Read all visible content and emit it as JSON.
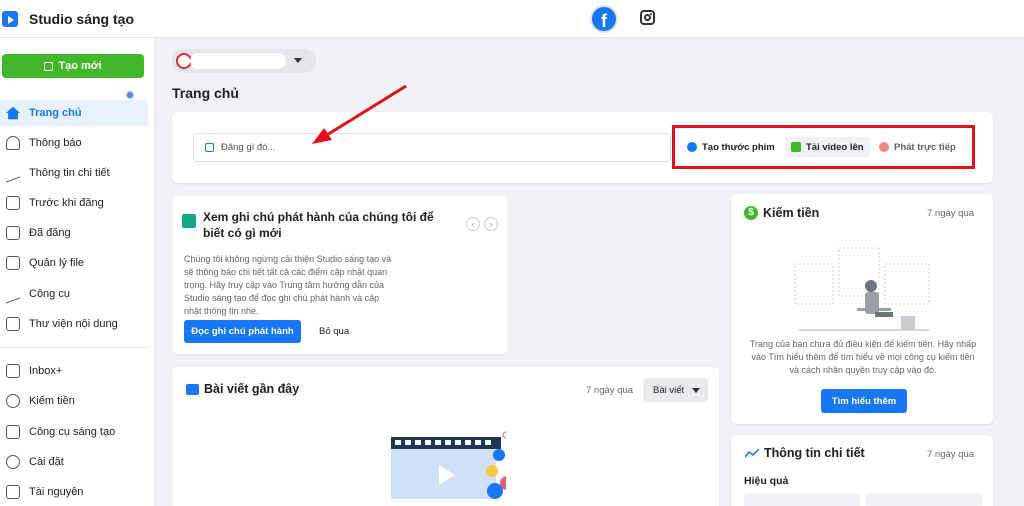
{
  "app": {
    "title": "Studio sáng tạo"
  },
  "topbar": {
    "platforms": [
      "facebook-icon",
      "instagram-icon"
    ]
  },
  "sidebar": {
    "create_label": "Tạo mới",
    "items": [
      {
        "label": "Trang chủ",
        "icon": "home-icon",
        "active": true
      },
      {
        "label": "Thông báo",
        "icon": "bell-icon"
      },
      {
        "label": "Thông tin chi tiết",
        "icon": "insights-icon"
      },
      {
        "label": "Trước khi đăng",
        "icon": "document-icon"
      },
      {
        "label": "Đã đăng",
        "icon": "calendar-icon"
      },
      {
        "label": "Quản lý file",
        "icon": "file-icon"
      },
      {
        "label": "Công cụ",
        "icon": "wrench-icon"
      },
      {
        "label": "Thư viện nội dung",
        "icon": "library-icon"
      },
      {
        "label": "Inbox+",
        "icon": "inbox-icon"
      },
      {
        "label": "Kiếm tiền",
        "icon": "dollar-icon"
      },
      {
        "label": "Công cụ sáng tạo",
        "icon": "creative-tools-icon"
      },
      {
        "label": "Cài đặt",
        "icon": "gear-icon"
      },
      {
        "label": "Tài nguyên",
        "icon": "resources-icon"
      }
    ]
  },
  "main": {
    "page_title": "Trang chủ",
    "composer": {
      "placeholder": "Đăng gì đó...",
      "actions": [
        {
          "label": "Tạo thước phim",
          "icon": "reel-icon"
        },
        {
          "label": "Tải video lên",
          "icon": "upload-video-icon"
        },
        {
          "label": "Phát trực tiếp",
          "icon": "live-icon"
        }
      ]
    },
    "release_notes": {
      "title": "Xem ghi chú phát hành của chúng tôi để biết có gì mới",
      "body": "Chúng tôi không ngừng cải thiện Studio sáng tạo và sẽ thông báo chi tiết tất cả các điểm cập nhật quan trọng. Hãy truy cập vào Trung tâm hướng dẫn của Studio sáng tạo để đọc ghi chú phát hành và cập nhật thông tin nhé.",
      "primary_label": "Đọc ghi chú phát hành",
      "skip_label": "Bỏ qua"
    },
    "recent_posts": {
      "title": "Bài viết gần đây",
      "time": "7 ngày qua",
      "filter": "Bài viết"
    },
    "monetization": {
      "title": "Kiếm tiền",
      "time": "7 ngày qua",
      "body": "Trang của bạn chưa đủ điều kiện để kiếm tiền. Hãy nhấp vào Tìm hiểu thêm để tìm hiểu về mọi công cụ kiếm tiền và cách nhận quyền truy cập vào đó.",
      "button": "Tìm hiểu thêm"
    },
    "insights": {
      "title": "Thông tin chi tiết",
      "time": "7 ngày qua",
      "subtitle": "Hiệu quả"
    }
  },
  "colors": {
    "accent": "#1877f2",
    "create": "#42b72a",
    "highlight": "#e0101c"
  }
}
